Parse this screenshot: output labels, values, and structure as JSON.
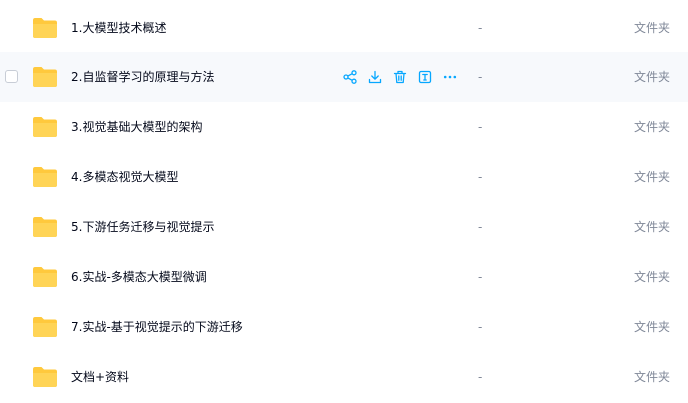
{
  "files": [
    {
      "name": "1.大模型技术概述",
      "size": "-",
      "type": "文件夹"
    },
    {
      "name": "2.自监督学习的原理与方法",
      "size": "-",
      "type": "文件夹"
    },
    {
      "name": "3.视觉基础大模型的架构",
      "size": "-",
      "type": "文件夹"
    },
    {
      "name": "4.多模态视觉大模型",
      "size": "-",
      "type": "文件夹"
    },
    {
      "name": "5.下游任务迁移与视觉提示",
      "size": "-",
      "type": "文件夹"
    },
    {
      "name": "6.实战-多模态大模型微调",
      "size": "-",
      "type": "文件夹"
    },
    {
      "name": "7.实战-基于视觉提示的下游迁移",
      "size": "-",
      "type": "文件夹"
    },
    {
      "name": "文档+资料",
      "size": "-",
      "type": "文件夹"
    }
  ],
  "hovered_row": 1,
  "row_actions": [
    "share-icon",
    "download-icon",
    "delete-icon",
    "rename-icon",
    "more-icon"
  ],
  "colors": {
    "accent": "#06a7ff",
    "folder": "#ffc93d",
    "text": "#03081a",
    "muted": "#818999",
    "hover_bg": "#f7f9fc"
  }
}
